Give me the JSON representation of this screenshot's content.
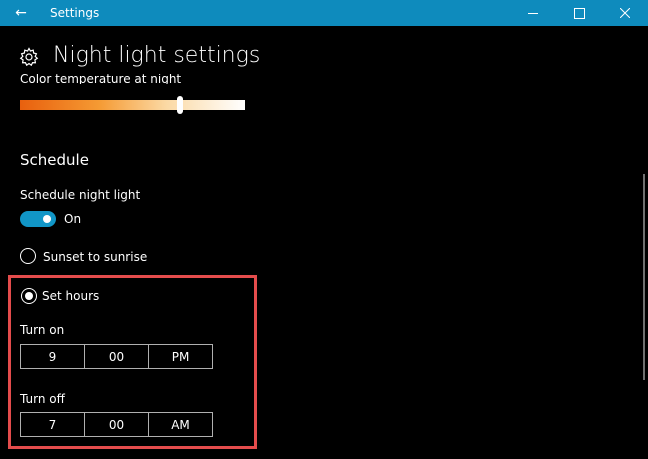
{
  "window": {
    "app_title": "Settings",
    "back_icon": "back-arrow-icon",
    "accent_color": "#0e8bbd"
  },
  "page": {
    "title": "Night light settings",
    "icon": "gear-icon"
  },
  "color_temperature": {
    "label": "Color temperature at night",
    "value_fraction": 0.71
  },
  "schedule": {
    "header": "Schedule",
    "toggle_label": "Schedule night light",
    "toggle_state": "On",
    "toggle_on": true,
    "options": {
      "sunset": "Sunset to sunrise",
      "set_hours": "Set hours"
    },
    "selected": "set_hours",
    "turn_on": {
      "label": "Turn on",
      "hour": "9",
      "minute": "00",
      "period": "PM"
    },
    "turn_off": {
      "label": "Turn off",
      "hour": "7",
      "minute": "00",
      "period": "AM"
    }
  },
  "highlight_color": "#e44c4c"
}
